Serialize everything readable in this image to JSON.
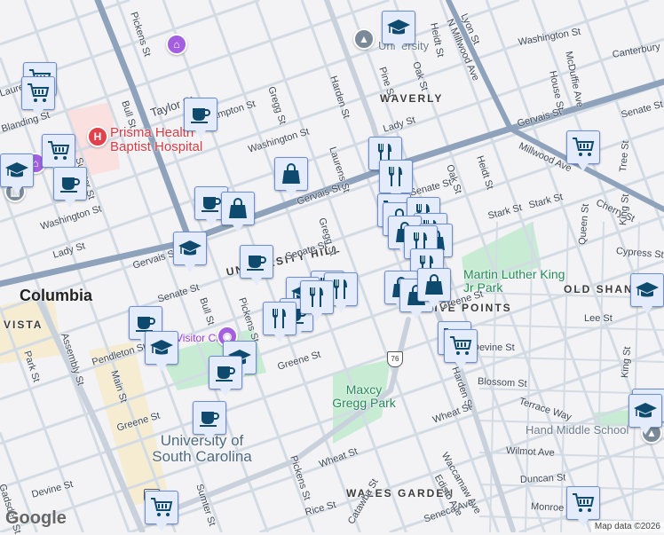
{
  "map": {
    "city_label": "Columbia",
    "neighborhoods": [
      "WAVERLY",
      "UNIVERSITY HILL",
      "VISTA",
      "OLD SHANDON",
      "FIVE POINTS",
      "WALES GARDEN"
    ],
    "pois": {
      "hospital": "Prisma Health Baptist Hospital",
      "park_mlk": "Martin Luther King Jr Park",
      "park_maxcy": "Maxcy Gregg Park",
      "university": "University",
      "usc": "University of South Carolina",
      "school": "Hand Middle School",
      "visitor": "Visitor Ctr"
    },
    "streets": {
      "gervais1": "Gervais St",
      "gervais2": "Gervais St",
      "gervais3": "Gervais St",
      "millwood": "Millwood Ave",
      "n_millwood": "N Millwood Ave",
      "harden": "Harden St",
      "harden2": "Harden St",
      "bull": "Bull St",
      "bull2": "Bull St",
      "taylor": "Taylor St",
      "hampton": "Hampton St",
      "washington1": "Washington St",
      "washington2": "Washington St",
      "washington3": "Washington St",
      "lady1": "Lady St",
      "lady2": "Lady St",
      "senate1": "Senate St",
      "senate2": "Senate St",
      "senate3": "Senate St",
      "senate4": "Senate St",
      "pickens1": "Pickens St",
      "pickens2": "Pickens St",
      "pickens3": "Pickens St",
      "gregg1": "Gregg St",
      "gregg2": "Gregg St",
      "laurens": "Laurens St",
      "pine": "Pine St",
      "oak1": "Oak St",
      "oak2": "Oak St",
      "heidt1": "Heidt St",
      "heidt2": "Heidt St",
      "lyon": "Lyon St",
      "house": "House St",
      "mcduffie": "McDuffie Ave",
      "canterbury": "Canterbury",
      "stark1": "Stark St",
      "stark2": "Stark St",
      "cherry": "Cherry St",
      "tree": "Tree St",
      "queen": "Queen St",
      "king1": "King St",
      "king2": "King St",
      "cypress": "Cypress St",
      "assembly": "Assembly St",
      "main": "Main St",
      "park": "Park St",
      "pendleton": "Pendleton St",
      "greene1": "Greene St",
      "greene2": "Greene St",
      "greene3": "Greene St",
      "sumter1": "Sumter St",
      "sumter2": "Sumter St",
      "devine1": "Devine St",
      "devine2": "Devine St",
      "lee": "Lee St",
      "blossom": "Blossom St",
      "terrace": "Terrace Way",
      "wheat1": "Wheat St",
      "wheat2": "Wheat St",
      "wilmot": "Wilmot Ave",
      "duncan": "Duncan St",
      "monroe": "Monroe St",
      "waccamaw": "Waccamaw Ave",
      "edisto": "Edisto Ave",
      "seneca": "Seneca Ave",
      "rice": "Rice St",
      "catawba": "Catawba St",
      "gadsden": "Gadsden St",
      "blanding": "Blanding St",
      "laurel": "Laurel St"
    },
    "route_shield": "76",
    "logo": "Google",
    "attribution": "Map data ©2026"
  },
  "marker_icons": [
    "coffee-cup",
    "shopping-cart",
    "shopping-bag",
    "fork-knife",
    "graduation-cap"
  ],
  "colors": {
    "marker_fill": "#e4ecfb",
    "marker_border": "#6c8ed8",
    "icon": "#0d4a6e",
    "arterial": "#8ea3bb",
    "street": "#d3dbe4",
    "park": "#c7ecd3",
    "hospital_area": "#fbe0e0"
  }
}
